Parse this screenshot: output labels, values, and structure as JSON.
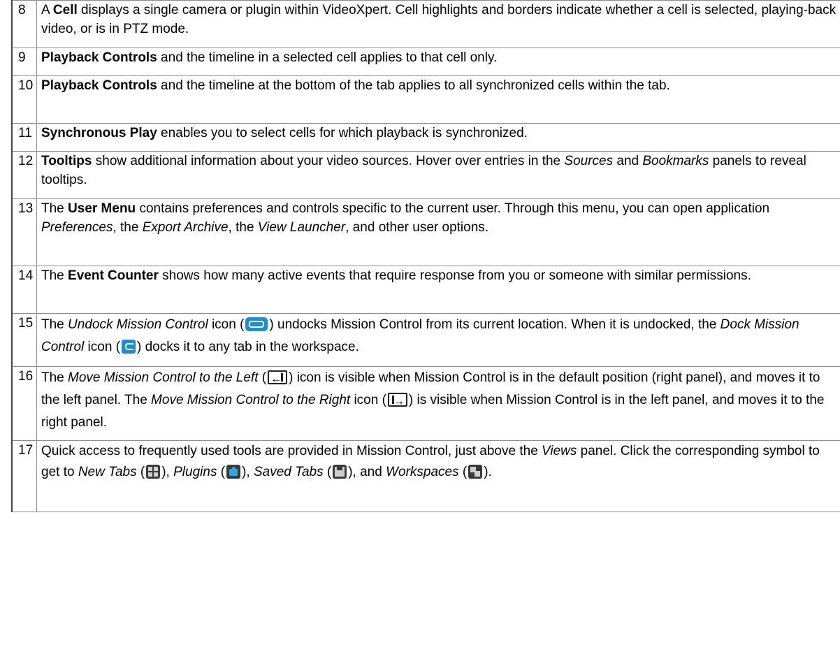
{
  "rows": [
    {
      "num": "8",
      "a": "A ",
      "b": "Cell",
      "c": " displays a single camera or plugin within VideoXpert. Cell highlights and borders indicate whether a cell is selected, playing-back video, or is in PTZ mode."
    },
    {
      "num": "9",
      "b": "Playback Controls",
      "c": " and the timeline in a selected cell applies to that cell only."
    },
    {
      "num": "10",
      "b": "Playback Controls",
      "c": " and the timeline at the bottom of the tab applies to all synchronized cells within the tab."
    },
    {
      "num": "11",
      "b": "Synchronous Play",
      "c": " enables you to select cells for which playback is synchronized."
    },
    {
      "num": "12",
      "b": "Tooltips",
      "c": " show additional information about your video sources. Hover over entries in the ",
      "i1": "Sources",
      "d": " and ",
      "i2": "Bookmarks",
      "e": " panels to reveal tooltips."
    },
    {
      "num": "13",
      "a": "The ",
      "b": "User Menu",
      "c": " contains preferences and controls specific to the current user. Through this menu, you can open application ",
      "i1": "Preferences",
      "d": ", the ",
      "i2": "Export Archive",
      "e": ", the ",
      "i3": "View Launcher",
      "f": ", and other user options."
    },
    {
      "num": "14",
      "a": "The ",
      "b": "Event Counter",
      "c": " shows how many active events that require response from you or someone with similar permissions."
    },
    {
      "num": "15",
      "a": "The ",
      "i1": "Undock Mission Control",
      "c": " icon (",
      "d": ") undocks Mission Control from its current location. When it is undocked, the ",
      "i2": "Dock Mission Control",
      "e": " icon (",
      "f": ") docks it to any tab in the workspace."
    },
    {
      "num": "16",
      "a": "The ",
      "i1": "Move Mission Control to the Left",
      "c": " (",
      "d": ") icon is visible when Mission Control is in the default position (right panel), and moves it to the left panel. The ",
      "i2": "Move Mission Control to the Right",
      "e": " icon (",
      "f": ") is visible when Mission Control is in the left panel, and moves it to the right panel."
    },
    {
      "num": "17",
      "a": "Quick access to frequently used tools are provided in Mission Control, just above the ",
      "i1": "Views",
      "c": " panel. Click the corresponding symbol to get to ",
      "i2": "New Tabs",
      "d": " (",
      "e": "), ",
      "i3": "Plugins",
      "f": " (",
      "g": "), ",
      "i4": "Saved Tabs",
      "h": " (",
      "j": "), and ",
      "i5": "Workspaces",
      "k": " (",
      "l": ")."
    }
  ]
}
